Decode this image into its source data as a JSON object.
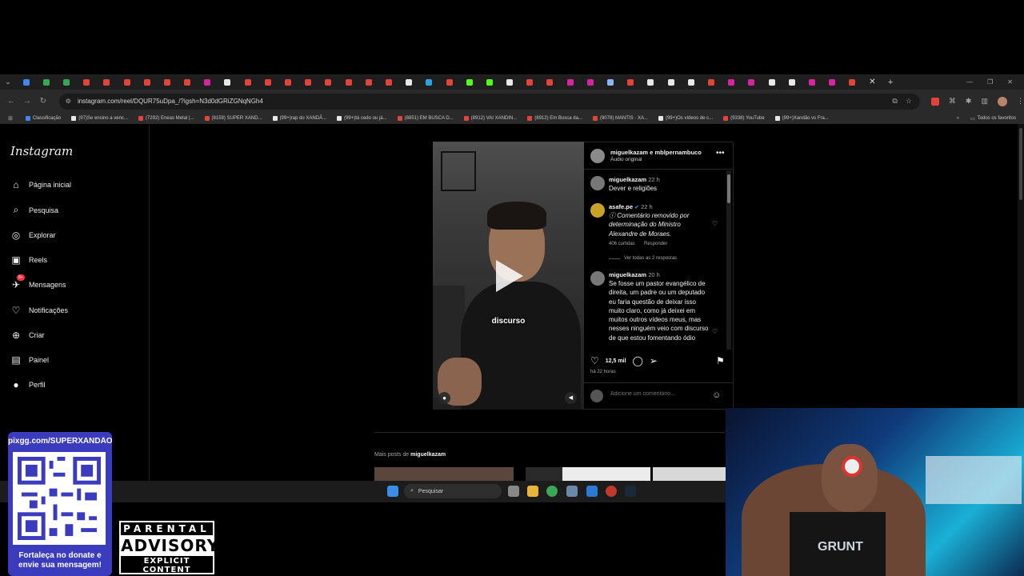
{
  "browser": {
    "tab_colors": [
      "#4285f4",
      "#34a853",
      "#34a853",
      "#e0443a",
      "#e0443a",
      "#e0443a",
      "#e0443a",
      "#e0443a",
      "#e0443a",
      "#d6249f",
      "#e8e8e8",
      "#e0443a",
      "#e0443a",
      "#e0443a",
      "#e0443a",
      "#e0443a",
      "#e0443a",
      "#e0443a",
      "#e0443a",
      "#e8e8e8",
      "#2aa3e0",
      "#e0443a",
      "#53fc18",
      "#53fc18",
      "#e8e8e8",
      "#e0443a",
      "#e0443a",
      "#d6249f",
      "#d6249f",
      "#8ab4f8",
      "#e0443a",
      "#e8e8e8",
      "#e8e8e8",
      "#e8e8e8",
      "#e0443a",
      "#d6249f",
      "#d6249f",
      "#e8e8e8",
      "#e8e8e8",
      "#d6249f",
      "#d6249f",
      "#e0443a"
    ],
    "url": "instagram.com/reel/DQUR75uDpa_/?igsh=N3d0dGRiZGNqNGh4",
    "bookmarks": [
      {
        "label": "Classificação",
        "color": "#4285f4"
      },
      {
        "label": "(97)Se ensino a venc...",
        "color": "#e8e8e8"
      },
      {
        "label": "(7292) Eneas Metal |...",
        "color": "#e0443a"
      },
      {
        "label": "(8159) SUPER XAND...",
        "color": "#e0443a"
      },
      {
        "label": "(99+)rap do XANDÃ...",
        "color": "#e8e8e8"
      },
      {
        "label": "(99+)tá cedo ou já...",
        "color": "#e8e8e8"
      },
      {
        "label": "(8851) EM BUSCA D...",
        "color": "#e0443a"
      },
      {
        "label": "(8912) VAI XANDIN...",
        "color": "#e0443a"
      },
      {
        "label": "(8912) Em Busca da...",
        "color": "#e0443a"
      },
      {
        "label": "(9078) MANTIS · XA...",
        "color": "#e0443a"
      },
      {
        "label": "(99+)Os vídeos de c...",
        "color": "#e8e8e8"
      },
      {
        "label": "(9338) YouTube",
        "color": "#e0443a"
      },
      {
        "label": "(99+)Xandão vs Fra...",
        "color": "#e8e8e8"
      }
    ],
    "all_bookmarks": "Todos os favoritos"
  },
  "instagram": {
    "logo": "Instagram",
    "nav": [
      {
        "label": "Página inicial",
        "icon": "home-icon",
        "glyph": "⌂"
      },
      {
        "label": "Pesquisa",
        "icon": "search-icon",
        "glyph": "⌕"
      },
      {
        "label": "Explorar",
        "icon": "compass-icon",
        "glyph": "◎"
      },
      {
        "label": "Reels",
        "icon": "reels-icon",
        "glyph": "▣"
      },
      {
        "label": "Mensagens",
        "icon": "messages-icon",
        "glyph": "✈",
        "badge": "9+"
      },
      {
        "label": "Notificações",
        "icon": "heart-icon",
        "glyph": "♡"
      },
      {
        "label": "Criar",
        "icon": "plus-icon",
        "glyph": "⊕"
      },
      {
        "label": "Painel",
        "icon": "dashboard-icon",
        "glyph": "▤"
      },
      {
        "label": "Perfil",
        "icon": "profile-icon",
        "glyph": "●"
      }
    ],
    "reel": {
      "caption_overlay": "discurso"
    },
    "post": {
      "authors": "miguelkazam e mblpernambuco",
      "audio": "Áudio original",
      "comments": [
        {
          "user": "miguelkazam",
          "time": "22 h",
          "text": "Dever e religiões"
        },
        {
          "user": "asafe.pe",
          "time": "22 h",
          "verified": true,
          "text": "ⓘ Comentário removido por determinação do Ministro Alexandre de Moraes.",
          "likes": "406 curtidas",
          "reply": "Responder",
          "view_replies": "Ver todas as 2 respostas"
        },
        {
          "user": "miguelkazam",
          "time": "20 h",
          "text": "Se fosse um pastor evangélico de direita, um padre ou um deputado eu faria questão de deixar isso muito claro, como já deixei em muitos outros vídeos meus, mas nesses ninguém veio com discurso de que estou fomentando ódio"
        }
      ],
      "likes": "12,5 mil",
      "posted_ago": "há 22 horas",
      "comment_placeholder": "Adicione um comentário..."
    },
    "more_posts_prefix": "Mais posts de",
    "more_posts_user": "miguelkazam"
  },
  "taskbar": {
    "search_label": "Pesquisar"
  },
  "overlay": {
    "pix_url": "pixgg.com/SUPERXANDÃO",
    "pix_message": "Fortaleça no donate e envie sua mensagem!",
    "advisory_line1": "PARENTAL",
    "advisory_line2": "ADVISORY",
    "advisory_line3": "EXPLICIT CONTENT",
    "webcam_shirt": "GRUNT"
  }
}
